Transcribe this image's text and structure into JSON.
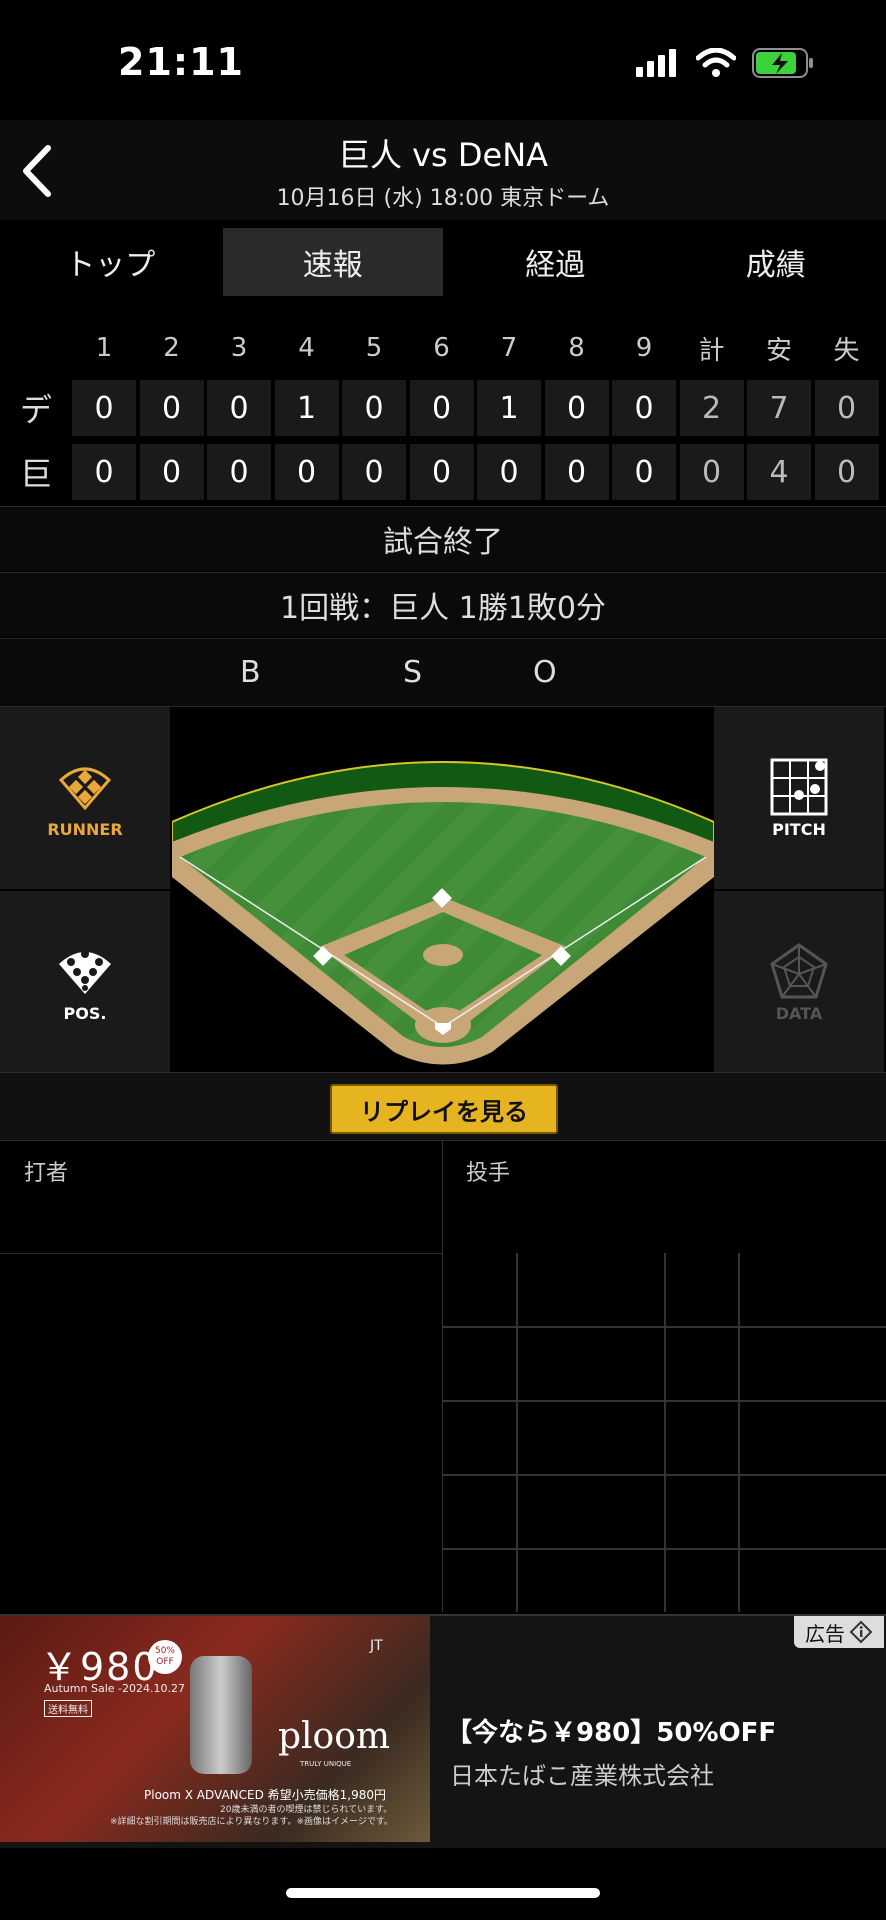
{
  "status": {
    "time": "21:11"
  },
  "header": {
    "title": "巨人 vs DeNA",
    "subtitle": "10月16日 (水) 18:00 東京ドーム"
  },
  "tabs": [
    {
      "label": "トップ",
      "active": false
    },
    {
      "label": "速報",
      "active": true
    },
    {
      "label": "経過",
      "active": false
    },
    {
      "label": "成績",
      "active": false
    }
  ],
  "scoreboard": {
    "headers": [
      "1",
      "2",
      "3",
      "4",
      "5",
      "6",
      "7",
      "8",
      "9",
      "計",
      "安",
      "失"
    ],
    "rows": [
      {
        "team": "デ",
        "scores": [
          "0",
          "0",
          "0",
          "1",
          "0",
          "0",
          "1",
          "0",
          "0",
          "2",
          "7",
          "0"
        ]
      },
      {
        "team": "巨",
        "scores": [
          "0",
          "0",
          "0",
          "0",
          "0",
          "0",
          "0",
          "0",
          "0",
          "0",
          "4",
          "0"
        ]
      }
    ]
  },
  "game_status": "試合終了",
  "series_record": "1回戦：巨人 1勝1敗0分",
  "count_labels": {
    "balls": "B",
    "strikes": "S",
    "outs": "O"
  },
  "field_buttons": {
    "runner": "RUNNER",
    "position": "POS.",
    "pitch": "PITCH",
    "data": "DATA"
  },
  "replay_button": "リプレイを見る",
  "batter_label": "打者",
  "pitcher_label": "投手",
  "ad": {
    "tag": "広告",
    "title": "【今なら￥980】50%OFF",
    "sponsor": "日本たばこ産業株式会社",
    "price": "￥980",
    "badge": "50% OFF",
    "sale": "Autumn Sale -2024.10.27",
    "shipping": "送料無料",
    "brand": "ploom",
    "brand_tag": "TRULY UNIQUE",
    "maker": "JT",
    "product_line": "Ploom X ADVANCED 希望小売価格1,980円",
    "notice1": "20歳未満の者の喫煙は禁じられています。",
    "notice2": "※詳細な割引期間は販売店により異なります。※画像はイメージです。"
  },
  "colors": {
    "accent": "#e6b421",
    "runner": "#e8a83a",
    "field_green": "#3f8a35",
    "dirt": "#c8a678"
  }
}
